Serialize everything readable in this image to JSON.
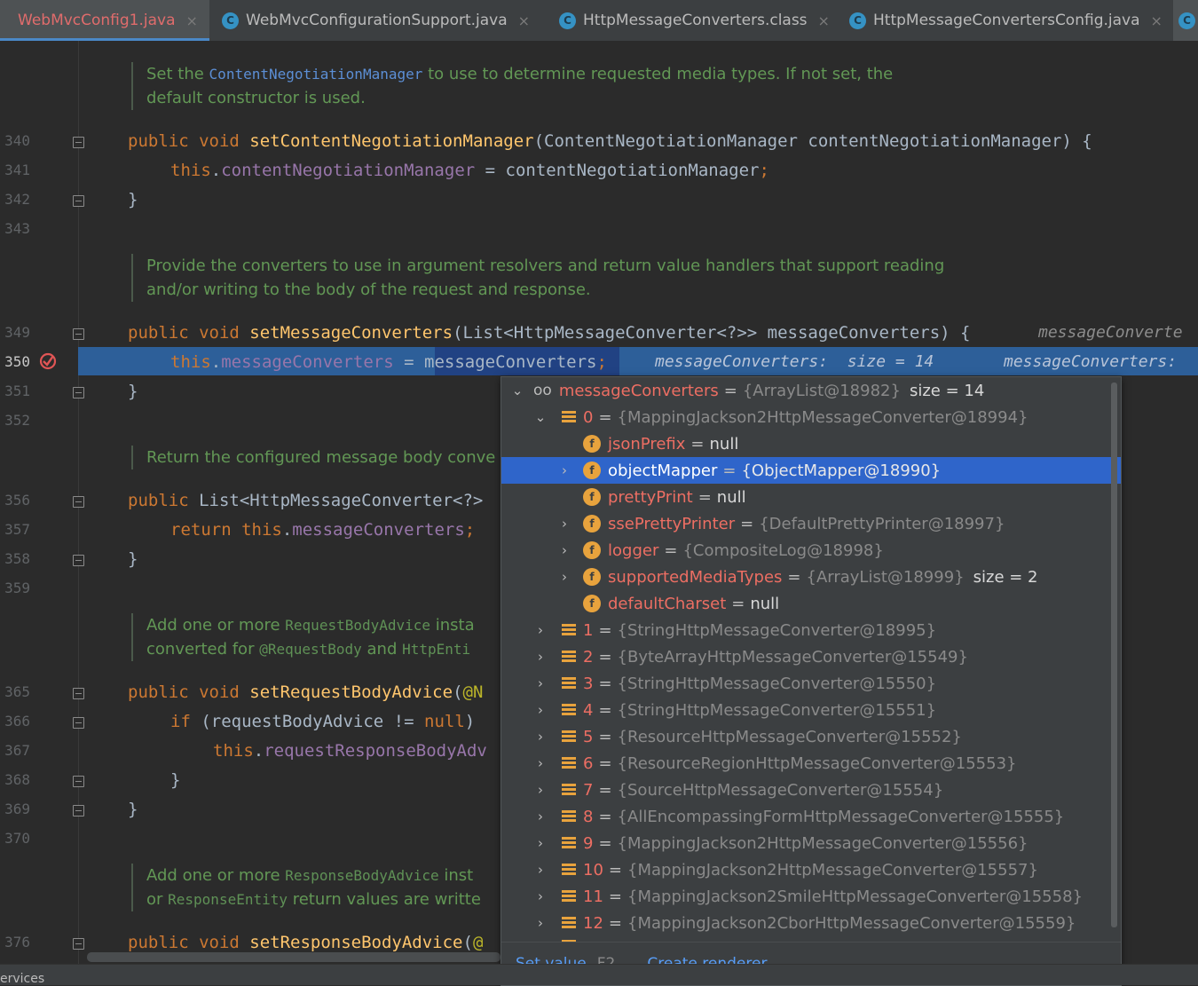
{
  "tabs": [
    {
      "label": "WebMvcConfig1.java",
      "icon": "class-icon",
      "active": true
    },
    {
      "label": "WebMvcConfigurationSupport.java",
      "icon": "class-icon"
    },
    {
      "label": "HttpMessageConverters.class",
      "icon": "class-icon"
    },
    {
      "label": "HttpMessageConvertersConfig.java",
      "icon": "class-icon"
    },
    {
      "label": "C",
      "icon": "class-icon"
    }
  ],
  "close_glyph": "×",
  "line_numbers": [
    "340",
    "341",
    "342",
    "343",
    "349",
    "350",
    "351",
    "352",
    "356",
    "357",
    "358",
    "359",
    "365",
    "366",
    "367",
    "368",
    "369",
    "370",
    "376"
  ],
  "docs": {
    "d1_pre": "Set the ",
    "d1_link": "ContentNegotiationManager",
    "d1_post": " to use to determine requested media types. If not set, the",
    "d1_line2": "default constructor is used.",
    "d2_line1": "Provide the converters to use in argument resolvers and return value handlers that support reading",
    "d2_line2": "and/or writing to the body of the request and response.",
    "d3_line1": "Return the configured message body conve",
    "d4_pre": "Add one or more ",
    "d4_code": "RequestBodyAdvice",
    "d4_post": " insta",
    "d4_l2a": "converted for ",
    "d4_l2b": "@RequestBody",
    "d4_l2c": " and ",
    "d4_l2d": "HttpEnti",
    "d5_pre": "Add one or more ",
    "d5_code": "ResponseBodyAdvice",
    "d5_post": " inst",
    "d5_l2a": "or ",
    "d5_l2b": "ResponseEntity",
    "d5_l2c": " return values are writte"
  },
  "code": {
    "l340_kw": "public void ",
    "l340_fn": "setContentNegotiationManager",
    "l340_rest": "(ContentNegotiationManager contentNegotiationManager) {",
    "l341_kw": "this",
    "l341_dot": ".",
    "l341_fld": "contentNegotiationManager",
    "l341_rest": " = contentNegotiationManager",
    "semi": ";",
    "brace_close": "}",
    "l349_kw": "public void ",
    "l349_fn": "setMessageConverters",
    "l349_rest": "(List<HttpMessageConverter<?>> messageConverters) {",
    "l349_hint": "messageConverte",
    "l350_kw": "this",
    "l350_dot": ".",
    "l350_fld": "messageConverters",
    "l350_eq": " = ",
    "l350_sel": "messageConverters",
    "l350_hint1": "messageConverters:  size = 14",
    "l350_hint2": "messageConverters:",
    "l356_kw": "public ",
    "l356_rest": "List<HttpMessageConverter<?>",
    "l357_kw": "return this",
    "l357_dot": ".",
    "l357_fld": "messageConverters",
    "l365_kw": "public void ",
    "l365_fn": "setRequestBodyAdvice",
    "l365_paren": "(",
    "l365_ann": "@N",
    "l366_kw": "if ",
    "l366_rest": "(requestBodyAdvice != ",
    "l366_null": "null",
    "l366_close": ")",
    "l367_kw": "this",
    "l367_dot": ".",
    "l367_fld": "requestResponseBodyAdv",
    "l376_kw": "public void ",
    "l376_fn": "setResponseBodyAdvice",
    "l376_paren": "(",
    "l376_ann": "@"
  },
  "debug_popup": {
    "root": {
      "name": "messageConverters",
      "value": "{ArrayList@18982}",
      "size": "size = 14"
    },
    "item0": {
      "name": "0",
      "value": "{MappingJackson2HttpMessageConverter@18994}"
    },
    "fields": [
      {
        "name": "jsonPrefix",
        "value": "null",
        "expandable": false
      },
      {
        "name": "objectMapper",
        "value": "{ObjectMapper@18990}",
        "expandable": true,
        "selected": true
      },
      {
        "name": "prettyPrint",
        "value": "null",
        "expandable": false
      },
      {
        "name": "ssePrettyPrinter",
        "value": "{DefaultPrettyPrinter@18997}",
        "expandable": true
      },
      {
        "name": "logger",
        "value": "{CompositeLog@18998}",
        "expandable": true
      },
      {
        "name": "supportedMediaTypes",
        "value": "{ArrayList@18999}",
        "size": "size = 2",
        "expandable": true
      },
      {
        "name": "defaultCharset",
        "value": "null",
        "expandable": false
      }
    ],
    "items": [
      {
        "name": "1",
        "value": "{StringHttpMessageConverter@18995}"
      },
      {
        "name": "2",
        "value": "{ByteArrayHttpMessageConverter@15549}"
      },
      {
        "name": "3",
        "value": "{StringHttpMessageConverter@15550}"
      },
      {
        "name": "4",
        "value": "{StringHttpMessageConverter@15551}"
      },
      {
        "name": "5",
        "value": "{ResourceHttpMessageConverter@15552}"
      },
      {
        "name": "6",
        "value": "{ResourceRegionHttpMessageConverter@15553}"
      },
      {
        "name": "7",
        "value": "{SourceHttpMessageConverter@15554}"
      },
      {
        "name": "8",
        "value": "{AllEncompassingFormHttpMessageConverter@15555}"
      },
      {
        "name": "9",
        "value": "{MappingJackson2HttpMessageConverter@15556}"
      },
      {
        "name": "10",
        "value": "{MappingJackson2HttpMessageConverter@15557}"
      },
      {
        "name": "11",
        "value": "{MappingJackson2SmileHttpMessageConverter@15558}"
      },
      {
        "name": "12",
        "value": "{MappingJackson2CborHttpMessageConverter@15559}"
      }
    ],
    "eq": "=",
    "field_glyph": "f",
    "expand_glyph": "›",
    "collapse_glyph": "⌄",
    "footer": {
      "set_value": "Set value",
      "set_value_key": "F2",
      "create_renderer": "Create renderer"
    }
  },
  "statusbar": {
    "text": "ervices"
  }
}
